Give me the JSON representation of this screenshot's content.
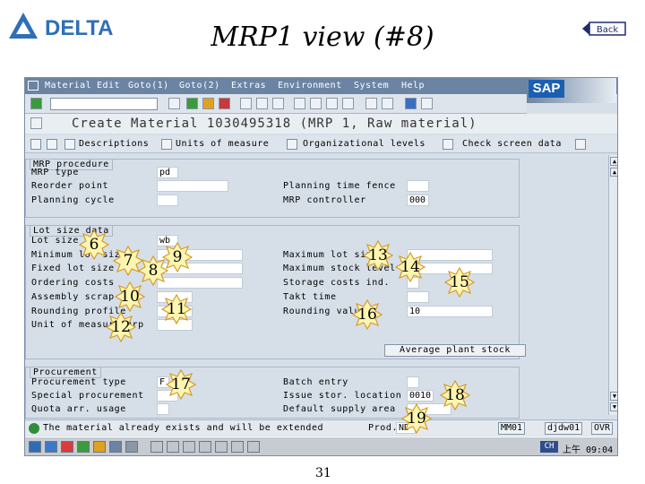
{
  "slide": {
    "logo_text": "DELTA",
    "title": "MRP1 view (#8)",
    "back_label": "Back",
    "page_number": "31"
  },
  "sap": {
    "menu": [
      "Material",
      "Edit",
      "Goto(1)",
      "Goto(2)",
      "Extras",
      "Environment",
      "System",
      "Help"
    ],
    "logo": "SAP",
    "screen_title": "Create Material 1030495318 (MRP 1, Raw material)",
    "app_toolbar": {
      "descriptions": "Descriptions",
      "units": "Units of measure",
      "org_levels": "Organizational levels",
      "check_screen": "Check screen data"
    },
    "mrp_procedure": {
      "title": "MRP procedure",
      "mrp_type_label": "MRP type",
      "mrp_type_value": "pd",
      "reorder_point_label": "Reorder point",
      "planning_fence_label": "Planning time fence",
      "planning_cycle_label": "Planning cycle",
      "mrp_controller_label": "MRP controller",
      "mrp_controller_value": "000"
    },
    "lot_size": {
      "title": "Lot size data",
      "lot_size_label": "Lot size",
      "lot_size_value": "wb",
      "min_lot_label": "Minimum lot size",
      "max_lot_label": "Maximum lot size",
      "fixed_lot_label": "Fixed lot size",
      "max_stock_label": "Maximum stock level",
      "ordering_costs_label": "Ordering costs",
      "storage_costs_label": "Storage costs ind.",
      "assembly_scrap_label": "Assembly scrap",
      "takt_time_label": "Takt time",
      "rounding_profile_label": "Rounding profile",
      "rounding_value_label": "Rounding value",
      "rounding_value": "10",
      "unit_measure_label": "Unit of measure grp",
      "avg_plant_stock_button": "Average plant stock"
    },
    "procurement": {
      "title": "Procurement",
      "proc_type_label": "Procurement type",
      "proc_type_value": "F",
      "batch_entry_label": "Batch entry",
      "special_proc_label": "Special procurement",
      "issue_loc_label": "Issue stor. location",
      "issue_loc_value": "0010",
      "quota_label": "Quota arr. usage",
      "default_supply_label": "Default supply area",
      "prod_label": "Prod.",
      "prod_value": "ND"
    },
    "status": {
      "message": "The material already exists and will be extended",
      "session": "MM01",
      "client": "djdw01",
      "mode": "OVR"
    },
    "taskbar": {
      "ime": "CH",
      "clock": "上午 09:04"
    }
  },
  "callouts": [
    "6",
    "7",
    "8",
    "9",
    "10",
    "11",
    "12",
    "13",
    "14",
    "15",
    "16",
    "17",
    "18",
    "19"
  ],
  "colors": {
    "sap_bg": "#d6dfe8",
    "menubar": "#6b84a3",
    "callout_fill": "#fdf6b0",
    "callout_stroke": "#d59a2a"
  }
}
